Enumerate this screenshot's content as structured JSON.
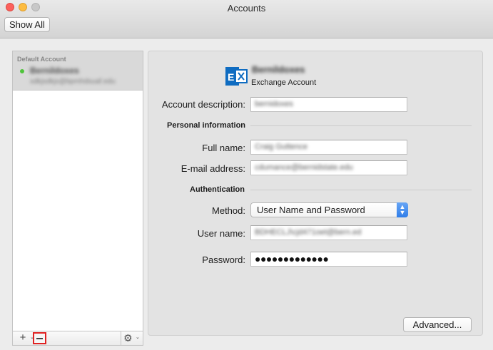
{
  "window": {
    "title": "Accounts",
    "show_all_label": "Show All"
  },
  "sidebar": {
    "group_label": "Default Account",
    "accounts": [
      {
        "name": "Bernildoxes",
        "email": "sdkjsdkjs@bpmhdsuaf.edu",
        "status_color": "#4fc43b"
      }
    ],
    "footer": {
      "add_icon": "plus-icon",
      "remove_icon": "minus-icon",
      "gear_icon": "gear-icon",
      "remove_highlight_color": "#e02222"
    }
  },
  "detail": {
    "account_name": "Bernildoxes",
    "account_type": "Exchange Account",
    "logo_icon": "exchange-logo-icon",
    "brand_color": "#0f6cc1",
    "fields": {
      "description_label": "Account description:",
      "description_value": "bernidoxes",
      "personal_section": "Personal information",
      "full_name_label": "Full name:",
      "full_name_value": "Craig Guttence",
      "email_label": "E-mail address:",
      "email_value": "cdumance@bernidstate.edu",
      "auth_section": "Authentication",
      "method_label": "Method:",
      "method_value": "User Name and Password",
      "username_label": "User name:",
      "username_value": "BDHECLJ\\cjd471oet@bern.ed",
      "password_label": "Password:",
      "password_value": "●●●●●●●●●●●●●"
    },
    "advanced_label": "Advanced..."
  }
}
